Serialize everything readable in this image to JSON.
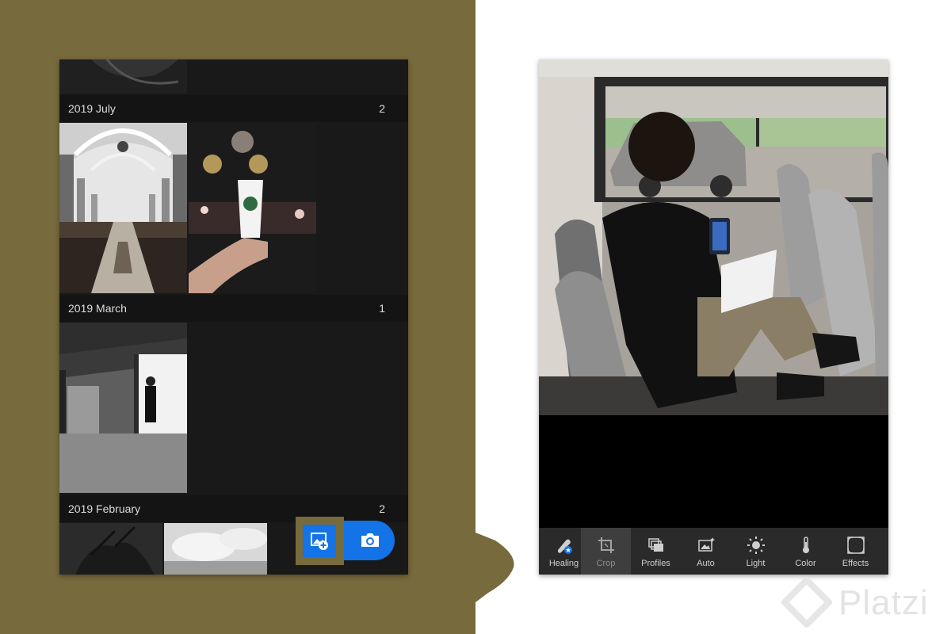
{
  "library": {
    "sections": [
      {
        "title": "2019 July",
        "count": "2"
      },
      {
        "title": "2019 March",
        "count": "1"
      },
      {
        "title": "2019 February",
        "count": "2"
      }
    ],
    "fab_gallery_icon": "add-photo-icon",
    "fab_camera_icon": "camera-icon"
  },
  "editor": {
    "tools": [
      {
        "label": "Healing",
        "icon": "healing-bandage-icon"
      },
      {
        "label": "Crop",
        "icon": "crop-icon"
      },
      {
        "label": "Profiles",
        "icon": "profiles-icon"
      },
      {
        "label": "Auto",
        "icon": "auto-icon"
      },
      {
        "label": "Light",
        "icon": "sun-icon"
      },
      {
        "label": "Color",
        "icon": "thermometer-icon"
      },
      {
        "label": "Effects",
        "icon": "effects-icon"
      }
    ],
    "active_tool": "Crop"
  },
  "watermark": {
    "brand": "Platzi"
  },
  "colors": {
    "olive": "#776a3c",
    "accent_blue": "#1473e6",
    "panel_dark": "#191919",
    "toolbar": "#2a2a2a"
  }
}
